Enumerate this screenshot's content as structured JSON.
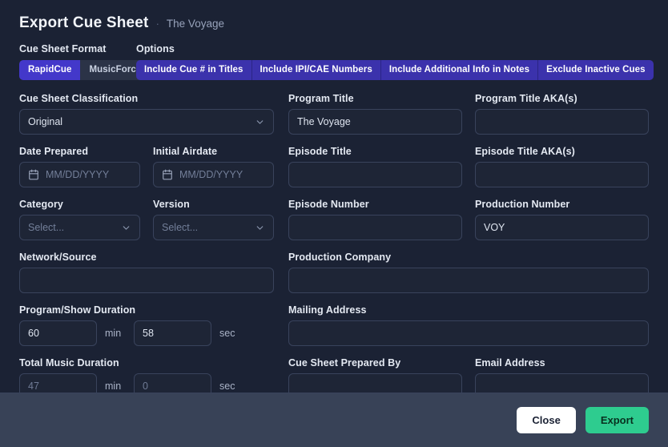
{
  "header": {
    "title": "Export Cue Sheet",
    "separator": "·",
    "subtitle": "The Voyage"
  },
  "format": {
    "label": "Cue Sheet Format",
    "options": [
      {
        "label": "RapidCue",
        "selected": true
      },
      {
        "label": "MusicForce",
        "selected": false
      }
    ]
  },
  "options": {
    "label": "Options",
    "items": [
      {
        "label": "Include Cue # in Titles",
        "active": true
      },
      {
        "label": "Include IPI/CAE Numbers",
        "active": true
      },
      {
        "label": "Include Additional Info in Notes",
        "active": true
      },
      {
        "label": "Exclude Inactive Cues",
        "active": true
      }
    ]
  },
  "fields": {
    "classification": {
      "label": "Cue Sheet Classification",
      "value": "Original"
    },
    "date_prepared": {
      "label": "Date Prepared",
      "placeholder": "MM/DD/YYYY",
      "value": ""
    },
    "initial_airdate": {
      "label": "Initial Airdate",
      "placeholder": "MM/DD/YYYY",
      "value": ""
    },
    "category": {
      "label": "Category",
      "placeholder": "Select...",
      "value": ""
    },
    "version": {
      "label": "Version",
      "placeholder": "Select...",
      "value": ""
    },
    "network_source": {
      "label": "Network/Source",
      "value": ""
    },
    "program_title": {
      "label": "Program Title",
      "value": "The Voyage"
    },
    "program_title_aka": {
      "label": "Program Title AKA(s)",
      "value": ""
    },
    "episode_title": {
      "label": "Episode Title",
      "value": ""
    },
    "episode_title_aka": {
      "label": "Episode Title AKA(s)",
      "value": ""
    },
    "episode_number": {
      "label": "Episode Number",
      "value": ""
    },
    "production_number": {
      "label": "Production Number",
      "value": "VOY"
    },
    "production_company": {
      "label": "Production Company",
      "value": ""
    },
    "mailing_address": {
      "label": "Mailing Address",
      "value": ""
    },
    "prepared_by": {
      "label": "Cue Sheet Prepared By",
      "value": ""
    },
    "email_address": {
      "label": "Email Address",
      "value": ""
    },
    "program_duration": {
      "label": "Program/Show Duration",
      "min": "60",
      "sec": "58",
      "min_unit": "min",
      "sec_unit": "sec"
    },
    "music_duration": {
      "label": "Total Music Duration",
      "min": "47",
      "sec": "0",
      "min_unit": "min",
      "sec_unit": "sec"
    }
  },
  "footer": {
    "close_label": "Close",
    "export_label": "Export"
  },
  "icons": {
    "calendar": "calendar-icon",
    "chevron": "chevron-down-icon"
  },
  "colors": {
    "background": "#1b2234",
    "footer": "#384257",
    "accent_purple": "#4338ca",
    "option_purple": "#3730a3",
    "export_green": "#2ecc8f",
    "border": "#39435c"
  }
}
